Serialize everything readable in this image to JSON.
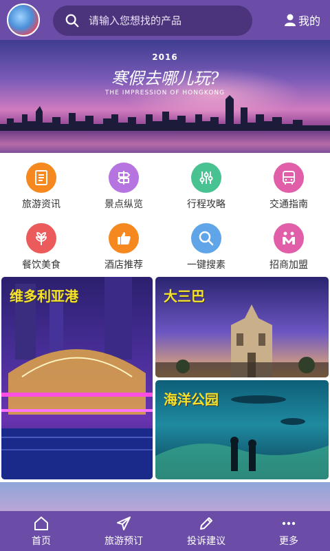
{
  "header": {
    "search_placeholder": "请输入您想找的产品",
    "profile_label": "我的"
  },
  "banner": {
    "year": "2016",
    "headline": "寒假去哪儿玩?",
    "subtitle": "THE IMPRESSION OF HONGKONG"
  },
  "categories": [
    {
      "label": "旅游资讯",
      "icon": "document-icon",
      "color": "#f5881f"
    },
    {
      "label": "景点纵览",
      "icon": "signpost-icon",
      "color": "#b574e0"
    },
    {
      "label": "行程攻略",
      "icon": "sliders-icon",
      "color": "#49c291"
    },
    {
      "label": "交通指南",
      "icon": "bus-icon",
      "color": "#e15fa8"
    },
    {
      "label": "餐饮美食",
      "icon": "leaf-icon",
      "color": "#ec5b5b"
    },
    {
      "label": "酒店推荐",
      "icon": "thumbs-up-icon",
      "color": "#f5881f"
    },
    {
      "label": "一键搜素",
      "icon": "search-icon",
      "color": "#5fa5e8"
    },
    {
      "label": "招商加盟",
      "icon": "merchant-icon",
      "color": "#e15fa8"
    }
  ],
  "featured": [
    {
      "title": "维多利亚港"
    },
    {
      "title": "大三巴"
    },
    {
      "title": "海洋公园"
    }
  ],
  "tabs": [
    {
      "label": "首页",
      "icon": "home-icon"
    },
    {
      "label": "旅游预订",
      "icon": "airplane-icon"
    },
    {
      "label": "投诉建议",
      "icon": "pen-icon"
    },
    {
      "label": "更多",
      "icon": "more-icon"
    }
  ]
}
